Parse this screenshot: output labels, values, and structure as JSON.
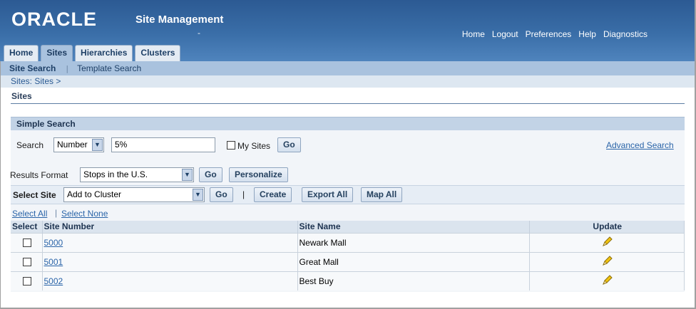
{
  "header": {
    "logo": "ORACLE",
    "app_title": "Site Management",
    "app_dash": "-",
    "global_links": [
      "Home",
      "Logout",
      "Preferences",
      "Help",
      "Diagnostics"
    ]
  },
  "tabs": [
    {
      "label": "Home",
      "active": false
    },
    {
      "label": "Sites",
      "active": true
    },
    {
      "label": "Hierarchies",
      "active": false
    },
    {
      "label": "Clusters",
      "active": false
    }
  ],
  "subtabs": {
    "active": "Site Search",
    "separator": "|",
    "other": "Template Search"
  },
  "breadcrumb": "Sites: Sites  >",
  "page_title": "Sites",
  "simple_search": {
    "header": "Simple Search",
    "search_label": "Search",
    "search_by": "Number",
    "search_value": "5%",
    "my_sites_label": "My Sites",
    "go": "Go",
    "advanced_search": "Advanced Search"
  },
  "results": {
    "format_label": "Results Format",
    "format_value": "Stops in the U.S.",
    "go": "Go",
    "personalize": "Personalize"
  },
  "actions": {
    "select_site_label": "Select Site",
    "select_site_value": "Add to Cluster",
    "go": "Go",
    "divider": "|",
    "create": "Create",
    "export_all": "Export All",
    "map_all": "Map All"
  },
  "selection": {
    "select_all": "Select All",
    "select_none": "Select None"
  },
  "table": {
    "columns": [
      "Select",
      "Site Number",
      "Site Name",
      "Update"
    ],
    "rows": [
      {
        "number": "5000",
        "name": "Newark Mall"
      },
      {
        "number": "5001",
        "name": "Great Mall"
      },
      {
        "number": "5002",
        "name": "Best Buy"
      }
    ]
  }
}
